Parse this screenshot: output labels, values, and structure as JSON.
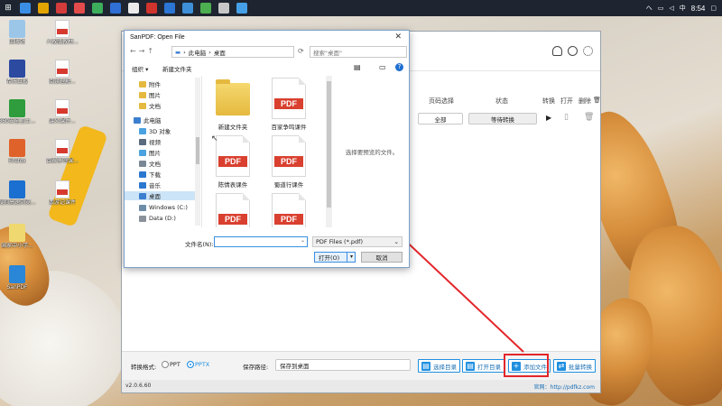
{
  "taskbar": {
    "time": "8:54",
    "tray_text": "へ",
    "lang": "中"
  },
  "desktop": {
    "icons": [
      {
        "label": "回收站",
        "kind": "recycle",
        "color": "#9cc6e8"
      },
      {
        "label": "人教版教材...",
        "kind": "pdf"
      },
      {
        "label": "希沃白板",
        "kind": "app",
        "color": "#2b4aa0"
      },
      {
        "label": "阅读理解...",
        "kind": "pdf"
      },
      {
        "label": "360安全卫士...",
        "kind": "app",
        "color": "#2f9c3d"
      },
      {
        "label": "讲义课件...",
        "kind": "pdf"
      },
      {
        "label": "Firefox",
        "kind": "app",
        "color": "#e0622b"
      },
      {
        "label": "百家争鸣课...",
        "kind": "pdf"
      },
      {
        "label": "搜狗高速浏览...",
        "kind": "app",
        "color": "#1b6fd0"
      },
      {
        "label": "西游记课件",
        "kind": "pdf"
      },
      {
        "label": "国家中小学...",
        "kind": "app",
        "color": "#f0d870"
      },
      {
        "label": "SanPDF",
        "kind": "app",
        "color": "#2a86d6"
      }
    ]
  },
  "app": {
    "columns": {
      "page_select": "页码选择",
      "status": "状态",
      "convert": "转换",
      "open": "打开",
      "delete": "删除"
    },
    "row": {
      "page_value": "全部",
      "status_value": "等待转换"
    },
    "bottom": {
      "format_label": "转换格式:",
      "opt_ppt": "PPT",
      "opt_pptx": "PPTX",
      "save_label": "保存路径:",
      "save_value": "保存到桌面",
      "btn_choose_dir": "选择目录",
      "btn_open_dir": "打开目录",
      "btn_add_file": "添加文件",
      "btn_batch": "批量转换"
    },
    "footer": {
      "version": "v2.0.6.60",
      "website": "官网：http://pdfkz.com"
    }
  },
  "dialog": {
    "title": "SanPDF: Open File",
    "close": "✕",
    "address": {
      "part1": "此电脑",
      "part2": "桌面"
    },
    "search_placeholder": "搜索\"桌面\"",
    "organize": "组织 ▾",
    "new_folder": "新建文件夹",
    "tree": [
      {
        "label": "附件",
        "color": "#e5b93f"
      },
      {
        "label": "图片",
        "color": "#e5b93f"
      },
      {
        "label": "文档",
        "color": "#e5b93f"
      },
      {
        "label": "此电脑",
        "color": "#3b7fd0"
      },
      {
        "label": "3D 对象",
        "color": "#4aa3e0"
      },
      {
        "label": "视频",
        "color": "#5a6b7d"
      },
      {
        "label": "图片",
        "color": "#4aa3e0"
      },
      {
        "label": "文档",
        "color": "#7a8896"
      },
      {
        "label": "下载",
        "color": "#2b78d0"
      },
      {
        "label": "音乐",
        "color": "#2b78d0"
      },
      {
        "label": "桌面",
        "color": "#3b7fd0"
      },
      {
        "label": "Windows (C:)",
        "color": "#6d8ca8"
      },
      {
        "label": "Data (D:)",
        "color": "#8a9199"
      }
    ],
    "files": [
      {
        "label": "新建文件夹",
        "kind": "folder"
      },
      {
        "label": "百家争鸣课件",
        "kind": "pdf"
      },
      {
        "label": "陈情表课件",
        "kind": "pdf"
      },
      {
        "label": "蜀道行课件",
        "kind": "pdf"
      },
      {
        "label": "",
        "kind": "pdf"
      },
      {
        "label": "",
        "kind": "pdf"
      }
    ],
    "pdf_badge": "PDF",
    "preview_text": "选择要预览的文件。",
    "filename_label": "文件名(N):",
    "filetype": "PDF Files (*.pdf)",
    "btn_open": "打开(O)",
    "btn_cancel": "取消"
  },
  "colors": {
    "accent": "#1f8fe0",
    "highlight": "#e3262b",
    "pdf_red": "#d9402f"
  }
}
